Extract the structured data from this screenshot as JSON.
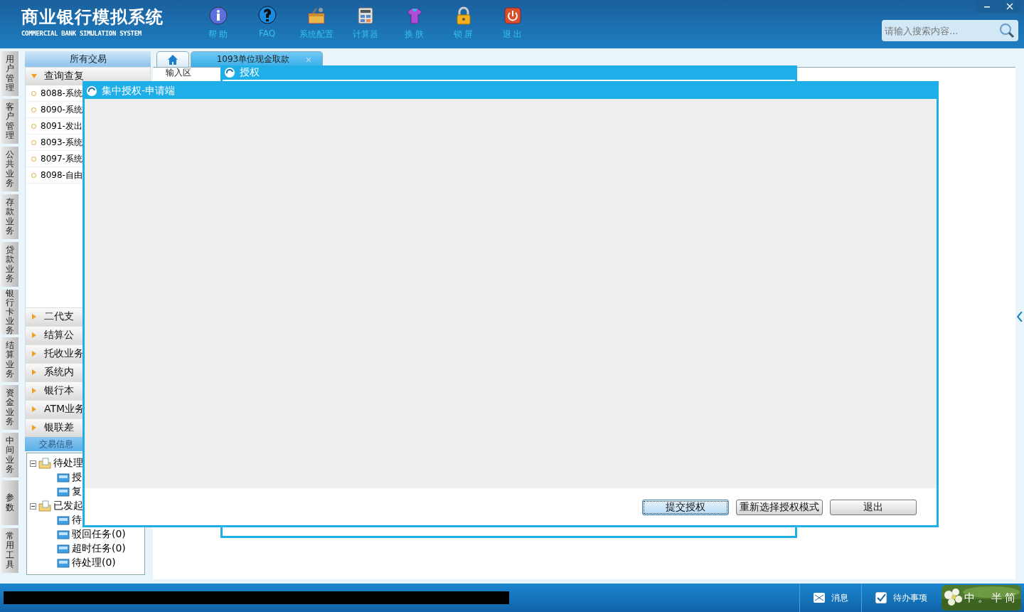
{
  "header": {
    "title": "商业银行模拟系统",
    "subtitle": "COMMERCIAL BANK SIMULATION SYSTEM",
    "tools": [
      {
        "label": "帮 助",
        "kind": "info"
      },
      {
        "label": "FAQ",
        "kind": "question"
      },
      {
        "label": "系统配置",
        "kind": "toolbox"
      },
      {
        "label": "计算器",
        "kind": "calculator"
      },
      {
        "label": "换 肤",
        "kind": "shirt"
      },
      {
        "label": "锁 屏",
        "kind": "lock"
      },
      {
        "label": "退 出",
        "kind": "power"
      }
    ],
    "search": {
      "placeholder": "请输入搜索内容..."
    }
  },
  "side_tabs": [
    "用户管理",
    "客户管理",
    "公共业务",
    "存款业务",
    "贷款业务",
    "银行卡业务",
    "结算业务",
    "资金业务",
    "中间业务",
    "参数",
    "常用工具"
  ],
  "nav": {
    "title": "所有交易",
    "groups": [
      {
        "label": "查询查复",
        "expanded": true,
        "items": [
          "8088-系统",
          "8090-系统",
          "8091-发出",
          "8093-系统",
          "8097-系统",
          "8098-自由"
        ]
      },
      {
        "label": "二代支",
        "expanded": false
      },
      {
        "label": "结算公",
        "expanded": false
      },
      {
        "label": "托收业务",
        "expanded": false
      },
      {
        "label": "系统内",
        "expanded": false
      },
      {
        "label": "银行本",
        "expanded": false
      },
      {
        "label": "ATM业务",
        "expanded": false
      },
      {
        "label": "银联差",
        "expanded": false
      }
    ]
  },
  "info_panel": {
    "title": "交易信息",
    "tree": [
      {
        "label": "待处理",
        "expanded": true,
        "children": [
          {
            "label": "授"
          },
          {
            "label": "复"
          }
        ]
      },
      {
        "label": "已发起",
        "expanded": true,
        "children": [
          {
            "label": "待"
          },
          {
            "label": "驳回任务(0)"
          },
          {
            "label": "超时任务(0)"
          },
          {
            "label": "待处理(0)"
          }
        ]
      }
    ]
  },
  "tabs": [
    {
      "kind": "home",
      "selected": false
    },
    {
      "kind": "page",
      "label": "1093单位现金取款",
      "selected": true
    }
  ],
  "background_window": {
    "title": "授权",
    "tab": "输入区"
  },
  "dialog": {
    "title": "集中授权-申请端",
    "buttons": [
      {
        "label": "提交授权",
        "focused": true
      },
      {
        "label": "重新选择授权模式",
        "focused": false
      },
      {
        "label": "退出",
        "focused": false
      }
    ]
  },
  "status_bar": {
    "items": [
      {
        "label": "消息",
        "kind": "mail"
      },
      {
        "label": "待办事项",
        "kind": "check"
      }
    ],
    "ime": [
      "中",
      "。",
      "半",
      "简"
    ]
  }
}
